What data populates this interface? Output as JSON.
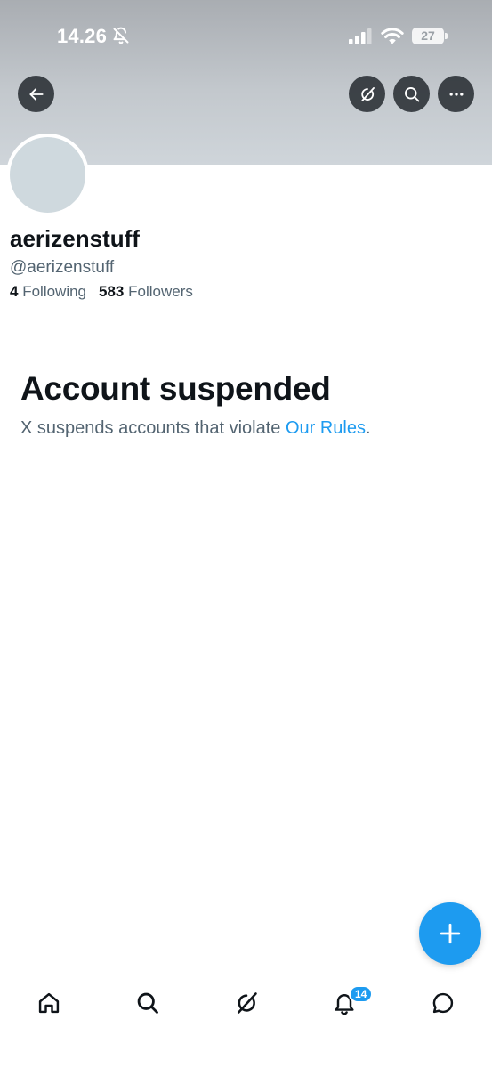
{
  "status_bar": {
    "time": "14.26",
    "battery_level": "27",
    "icons": [
      "bell-off-icon",
      "signal-icon",
      "wifi-icon",
      "battery-icon"
    ]
  },
  "header_actions": {
    "back_icon": "arrow-left-icon",
    "grok_icon": "grok-icon",
    "search_icon": "search-icon",
    "more_icon": "more-horizontal-icon"
  },
  "profile": {
    "display_name": "aerizenstuff",
    "handle": "@aerizenstuff",
    "following_count": "4",
    "following_label": "Following",
    "followers_count": "583",
    "followers_label": "Followers"
  },
  "suspension": {
    "title": "Account suspended",
    "message": "X suspends accounts that violate ",
    "link_text": "Our Rules",
    "trailing": "."
  },
  "fab": {
    "icon": "plus-icon"
  },
  "bottom_nav": {
    "items": [
      {
        "name": "home",
        "icon": "home-icon"
      },
      {
        "name": "search",
        "icon": "search-icon"
      },
      {
        "name": "grok",
        "icon": "grok-icon"
      },
      {
        "name": "notifications",
        "icon": "bell-icon",
        "badge": "14"
      },
      {
        "name": "messages",
        "icon": "message-icon"
      }
    ]
  },
  "colors": {
    "accent": "#1d9bf0",
    "text_primary": "#0f1419",
    "text_secondary": "#536471",
    "avatar_placeholder": "#cfd9de"
  }
}
